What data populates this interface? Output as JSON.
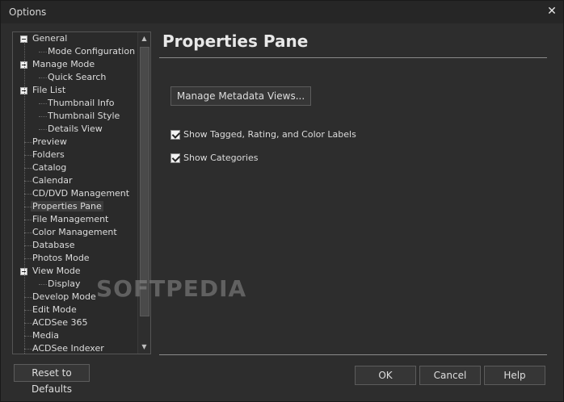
{
  "window": {
    "title": "Options",
    "close_icon": "close-icon"
  },
  "tree": {
    "items": [
      {
        "label": "General",
        "level": 0,
        "expander": true
      },
      {
        "label": "Mode Configuration",
        "level": 1
      },
      {
        "label": "Manage Mode",
        "level": 0,
        "expander": true
      },
      {
        "label": "Quick Search",
        "level": 1
      },
      {
        "label": "File List",
        "level": 0,
        "expander": true
      },
      {
        "label": "Thumbnail Info",
        "level": 1
      },
      {
        "label": "Thumbnail Style",
        "level": 1
      },
      {
        "label": "Details View",
        "level": 1
      },
      {
        "label": "Preview",
        "level": 0
      },
      {
        "label": "Folders",
        "level": 0
      },
      {
        "label": "Catalog",
        "level": 0
      },
      {
        "label": "Calendar",
        "level": 0
      },
      {
        "label": "CD/DVD Management",
        "level": 0
      },
      {
        "label": "Properties Pane",
        "level": 0,
        "selected": true
      },
      {
        "label": "File Management",
        "level": 0
      },
      {
        "label": "Color Management",
        "level": 0
      },
      {
        "label": "Database",
        "level": 0
      },
      {
        "label": "Photos Mode",
        "level": 0
      },
      {
        "label": "View Mode",
        "level": 0,
        "expander": true
      },
      {
        "label": "Display",
        "level": 1
      },
      {
        "label": "Develop Mode",
        "level": 0
      },
      {
        "label": "Edit Mode",
        "level": 0
      },
      {
        "label": "ACDSee 365",
        "level": 0
      },
      {
        "label": "Media",
        "level": 0
      },
      {
        "label": "ACDSee Indexer",
        "level": 0
      }
    ]
  },
  "pane": {
    "title": "Properties Pane",
    "manage_button": "Manage Metadata Views...",
    "options": [
      {
        "label": "Show Tagged, Rating, and Color Labels",
        "checked": true
      },
      {
        "label": "Show Categories",
        "checked": true
      }
    ]
  },
  "footer": {
    "reset_label": "Reset to Defaults",
    "ok_label": "OK",
    "cancel_label": "Cancel",
    "help_label": "Help"
  },
  "watermark": "SOFTPEDIA"
}
